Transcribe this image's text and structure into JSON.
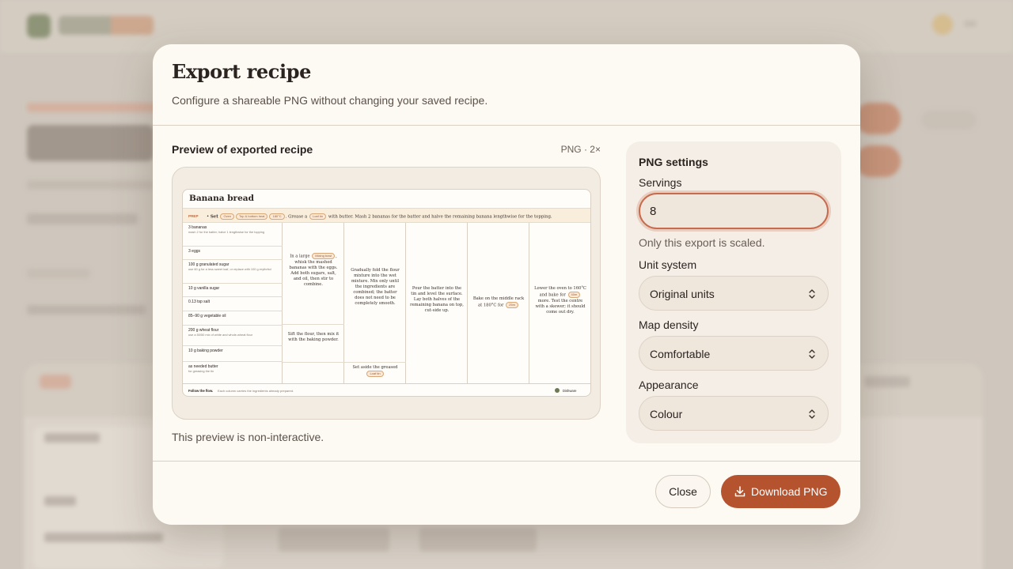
{
  "modal": {
    "title": "Export recipe",
    "subtitle": "Configure a shareable PNG without changing your saved recipe."
  },
  "preview": {
    "label": "Preview of exported recipe",
    "meta": "PNG · 2×",
    "note": "This preview is non-interactive.",
    "recipe": {
      "title": "Banana bread",
      "prep": {
        "label": "PREP",
        "set_word": "Set",
        "chip_oven": "Oven",
        "chip_heat": "Top & bottom heat",
        "chip_temp": "180°C",
        "grease": ". Grease a",
        "chip_tin": "Loaf tin",
        "rest": "with butter. Mash 2 bananas for the batter and halve the remaining banana lengthwise for the topping."
      },
      "ingredients": [
        {
          "name": "3 bananas",
          "note": "mash 2 for the batter; halve 1 lengthwise for the topping"
        },
        {
          "name": "3 eggs",
          "note": ""
        },
        {
          "name": "100 g granulated sugar",
          "note": "use 60 g for a less sweet loaf, or replace with 100 g erythritol"
        },
        {
          "name": "10 g vanilla sugar",
          "note": ""
        },
        {
          "name": "0.13 tsp salt",
          "note": ""
        },
        {
          "name": "85–90 g vegetable oil",
          "note": ""
        },
        {
          "name": "200 g wheat flour",
          "note": "use a 50/50 mix of white and whole-wheat flour"
        },
        {
          "name": "10 g baking powder",
          "note": ""
        },
        {
          "name": "as needed butter",
          "note": "for greasing the tin"
        }
      ],
      "steps": {
        "s1a": "In a large",
        "s1_chip": "Mixing bowl",
        "s1b": ", whisk the mashed bananas with the eggs. Add both sugars, salt, and oil, then stir to combine.",
        "s2": "Sift the flour, then mix it with the baking powder.",
        "s3": "Gradually fold the flour mixture into the wet mixture. Mix only until the ingredients are combined; the batter does not need to be completely smooth.",
        "s4a": "Set aside the greased",
        "s4_chip": "Loaf tin",
        "s5": "Pour the batter into the tin and level the surface. Lay both halves of the remaining banana on top, cut-side up.",
        "s6a": "Bake on the middle rack at 180°C for",
        "s6_chip": "25m",
        "s7a": "Lower the oven to 160°C and bake for",
        "s7_chip": "40m",
        "s7b": "more. Test the centre with a skewer; it should come out dry."
      },
      "footer": {
        "label": "Follow the flow.",
        "note": "Each column carries the ingredients already prepared.",
        "badge": "Dishware"
      }
    }
  },
  "settings": {
    "title": "PNG settings",
    "servings_label": "Servings",
    "servings_value": "8",
    "servings_help": "Only this export is scaled.",
    "unit_label": "Unit system",
    "unit_value": "Original units",
    "density_label": "Map density",
    "density_value": "Comfortable",
    "appearance_label": "Appearance",
    "appearance_value": "Colour"
  },
  "actions": {
    "close": "Close",
    "download": "Download PNG"
  },
  "colors": {
    "accent": "#b5532f",
    "focus_ring": "#c66b4d",
    "modal_bg": "#fdfaf4",
    "panel_bg": "#f4eee6"
  }
}
